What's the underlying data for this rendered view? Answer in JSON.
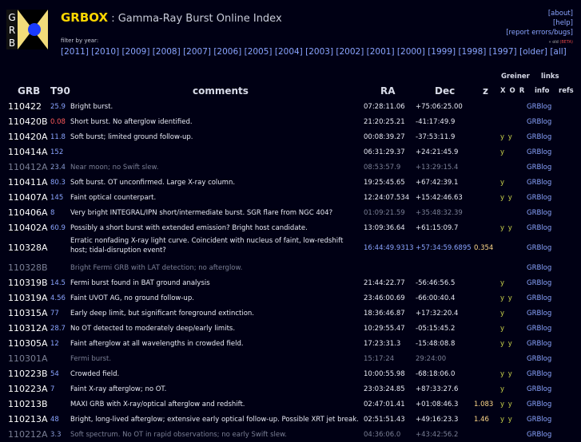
{
  "header": {
    "logo_letters": [
      "G",
      "R",
      "B"
    ],
    "title": "GRBOX",
    "subtitle": " : Gamma-Ray Burst Online Index",
    "filter_label": "filter by year:",
    "years": [
      "[2011]",
      "[2010]",
      "[2009]",
      "[2008]",
      "[2007]",
      "[2006]",
      "[2005]",
      "[2004]",
      "[2003]",
      "[2002]",
      "[2001]",
      "[2000]",
      "[1999]",
      "[1998]",
      "[1997]",
      "[older]",
      "[all]"
    ],
    "about": "[about]",
    "help": "[help]",
    "report": "[report errors/bugs]",
    "beta_prefix": "» old ",
    "beta": "(BETA)"
  },
  "columns": {
    "grb": "GRB",
    "t90": "T90",
    "comments": "comments",
    "ra": "RA",
    "dec": "Dec",
    "z": "z",
    "greiner": "Greiner",
    "xor": "X O R",
    "links": "links",
    "info": "info",
    "refs": "refs"
  },
  "colors": {
    "background": "#000014",
    "title": "#ffd700",
    "link": "#8aa4ff",
    "dim": "#7a7f95",
    "t90_short": "#ff5a5a",
    "t90_long": "#8aa4ff",
    "t90_extra": "#9be15d",
    "xor": "#c9d24a",
    "redshift": "#ffd98a"
  },
  "rows": [
    {
      "grb": "110422",
      "t90": "25.9",
      "t90c": "blue",
      "comment": "Bright burst.",
      "ra": "07:28:11.06",
      "dec": "+75:06:25.00",
      "z": "",
      "xor": "",
      "info": "GRBlog",
      "dim": false
    },
    {
      "grb": "110420B",
      "t90": "0.08",
      "t90c": "red",
      "comment": "Short burst. No afterglow identified.",
      "ra": "21:20:25.21",
      "dec": "-41:17:49.9",
      "z": "",
      "xor": "",
      "info": "GRBlog",
      "dim": false
    },
    {
      "grb": "110420A",
      "t90": "11.8",
      "t90c": "blue",
      "comment": "Soft burst; limited ground follow-up.",
      "ra": "00:08:39.27",
      "dec": "-37:53:11.9",
      "z": "",
      "xor": "y y",
      "info": "GRBlog",
      "dim": false
    },
    {
      "grb": "110414A",
      "t90": "152",
      "t90c": "blue",
      "comment": "",
      "ra": "06:31:29.37",
      "dec": "+24:21:45.9",
      "z": "",
      "xor": "y",
      "info": "GRBlog",
      "dim": false
    },
    {
      "grb": "110412A",
      "t90": "23.4",
      "t90c": "blue",
      "comment": "Near moon; no Swift slew.",
      "ra": "08:53:57.9",
      "dec": "+13:29:15.4",
      "z": "",
      "xor": "",
      "info": "GRBlog",
      "dim": true
    },
    {
      "grb": "110411A",
      "t90": "80.3",
      "t90c": "blue",
      "comment": "Soft burst. OT unconfirmed. Large X-ray column.",
      "ra": "19:25:45.65",
      "dec": "+67:42:39.1",
      "z": "",
      "xor": "y",
      "info": "GRBlog",
      "dim": false
    },
    {
      "grb": "110407A",
      "t90": "145",
      "t90c": "blue",
      "comment": "Faint optical counterpart.",
      "ra": "12:24:07.534",
      "dec": "+15:42:46.63",
      "z": "",
      "xor": "y y",
      "info": "GRBlog",
      "dim": false
    },
    {
      "grb": "110406A",
      "t90": "8",
      "t90c": "blue",
      "comment": "Very bright INTEGRAL/IPN short/intermediate burst. SGR flare from NGC 404?",
      "ra": "01:09:21.59",
      "dec": "+35:48:32.39",
      "z": "",
      "xor": "",
      "info": "GRBlog",
      "dim": false,
      "dimcoords": true
    },
    {
      "grb": "110402A",
      "t90": "60.9",
      "t90c": "blue",
      "comment": "Possibly a short burst with extended emission? Bright host candidate.",
      "ra": "13:09:36.64",
      "dec": "+61:15:09.7",
      "z": "",
      "xor": "y y",
      "info": "GRBlog",
      "dim": false
    },
    {
      "grb": "110328A",
      "t90": "",
      "t90c": "blue",
      "comment": "Erratic nonfading X-ray light curve. Coincident with nucleus of faint, low-redshift host; tidal-disruption event?",
      "ra": "16:44:49.9313",
      "dec": "+57:34:59.6895",
      "z": "0.354",
      "xor": "",
      "info": "GRBlog",
      "dim": false,
      "tall": true,
      "bluecoords": true
    },
    {
      "grb": "110328B",
      "t90": "",
      "t90c": "blue",
      "comment": "Bright Fermi GRB with LAT detection; no afterglow.",
      "ra": "",
      "dec": "",
      "z": "",
      "xor": "",
      "info": "GRBlog",
      "dim": true
    },
    {
      "grb": "110319B",
      "t90": "14.5",
      "t90c": "blue",
      "comment": "Fermi burst found in BAT ground analysis",
      "ra": "21:44:22.77",
      "dec": "-56:46:56.5",
      "z": "",
      "xor": "y",
      "info": "GRBlog",
      "dim": false
    },
    {
      "grb": "110319A",
      "t90": "4.56",
      "t90c": "blue",
      "comment": "Faint UVOT AG, no ground follow-up.",
      "ra": "23:46:00.69",
      "dec": "-66:00:40.4",
      "z": "",
      "xor": "y y",
      "info": "GRBlog",
      "dim": false
    },
    {
      "grb": "110315A",
      "t90": "77",
      "t90c": "blue",
      "comment": "Early deep limit, but significant foreground extinction.",
      "ra": "18:36:46.87",
      "dec": "+17:32:20.4",
      "z": "",
      "xor": "y",
      "info": "GRBlog",
      "dim": false
    },
    {
      "grb": "110312A",
      "t90": "28.7",
      "t90c": "blue",
      "comment": "No OT detected to moderately deep/early limits.",
      "ra": "10:29:55.47",
      "dec": "-05:15:45.2",
      "z": "",
      "xor": "y",
      "info": "GRBlog",
      "dim": false
    },
    {
      "grb": "110305A",
      "t90": "12",
      "t90c": "blue",
      "comment": "Faint afterglow at all wavelengths in crowded field.",
      "ra": "17:23:31.3",
      "dec": "-15:48:08.8",
      "z": "",
      "xor": "y y",
      "info": "GRBlog",
      "dim": false
    },
    {
      "grb": "110301A",
      "t90": "",
      "t90c": "blue",
      "comment": "Fermi burst.",
      "ra": "15:17:24",
      "dec": "29:24:00",
      "z": "",
      "xor": "",
      "info": "GRBlog",
      "dim": true
    },
    {
      "grb": "110223B",
      "t90": "54",
      "t90c": "blue",
      "comment": "Crowded field.",
      "ra": "10:00:55.98",
      "dec": "-68:18:06.0",
      "z": "",
      "xor": "y y",
      "info": "GRBlog",
      "dim": false
    },
    {
      "grb": "110223A",
      "t90": "7",
      "t90c": "blue",
      "comment": "Faint X-ray afterglow; no OT.",
      "ra": "23:03:24.85",
      "dec": "+87:33:27.6",
      "z": "",
      "xor": "y",
      "info": "GRBlog",
      "dim": false
    },
    {
      "grb": "110213B",
      "t90": "",
      "t90c": "blue",
      "comment": "MAXI GRB with X-ray/optical afterglow and redshift.",
      "ra": "02:47:01.41",
      "dec": "+01:08:46.3",
      "z": "1.083",
      "xor": "y y",
      "info": "GRBlog",
      "dim": false
    },
    {
      "grb": "110213A",
      "t90": "48",
      "t90c": "blue",
      "comment": "Bright, long-lived afterglow; extensive early optical follow-up. Possible XRT jet break.",
      "ra": "02:51:51.43",
      "dec": "+49:16:23.3",
      "z": "1.46",
      "xor": "y y",
      "info": "GRBlog",
      "dim": false
    },
    {
      "grb": "110212A",
      "t90": "3.3",
      "t90c": "green",
      "comment": "Soft spectrum. No OT in rapid observations; no early Swift slew.",
      "ra": "04:36:06.0",
      "dec": "+43:42:56.2",
      "z": "",
      "xor": "",
      "info": "GRBlog",
      "dim": true
    }
  ]
}
